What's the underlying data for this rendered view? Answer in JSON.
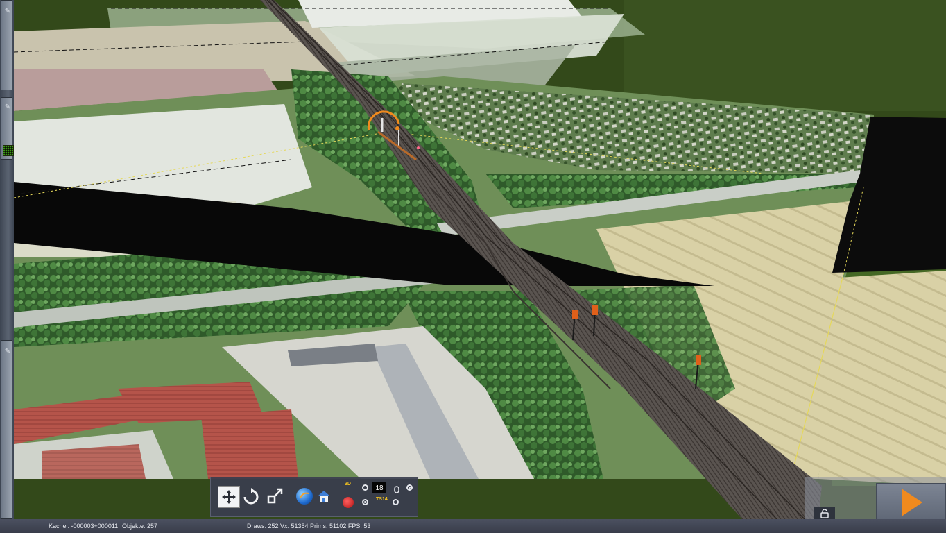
{
  "status_bar": {
    "tile": "Kachel: -000003+000011",
    "objects": "Objekte: 257",
    "stats": "Draws: 252 Vx: 51354 Prims: 51102 FPS: 53"
  },
  "toolbar": {
    "value_box": "18",
    "label_3d": "3D",
    "label_ts": "TS14"
  },
  "colors": {
    "accent_orange": "#f08a1e",
    "toolbar_bg": "#3a3e4e",
    "status_bg": "#393d4a"
  },
  "icons": {
    "move": "move-arrows-icon",
    "rotate": "rotate-icon",
    "scale": "scale-arrows-icon",
    "globe": "globe-icon",
    "home": "home-icon",
    "play": "play-icon",
    "lock": "lock-icon"
  }
}
